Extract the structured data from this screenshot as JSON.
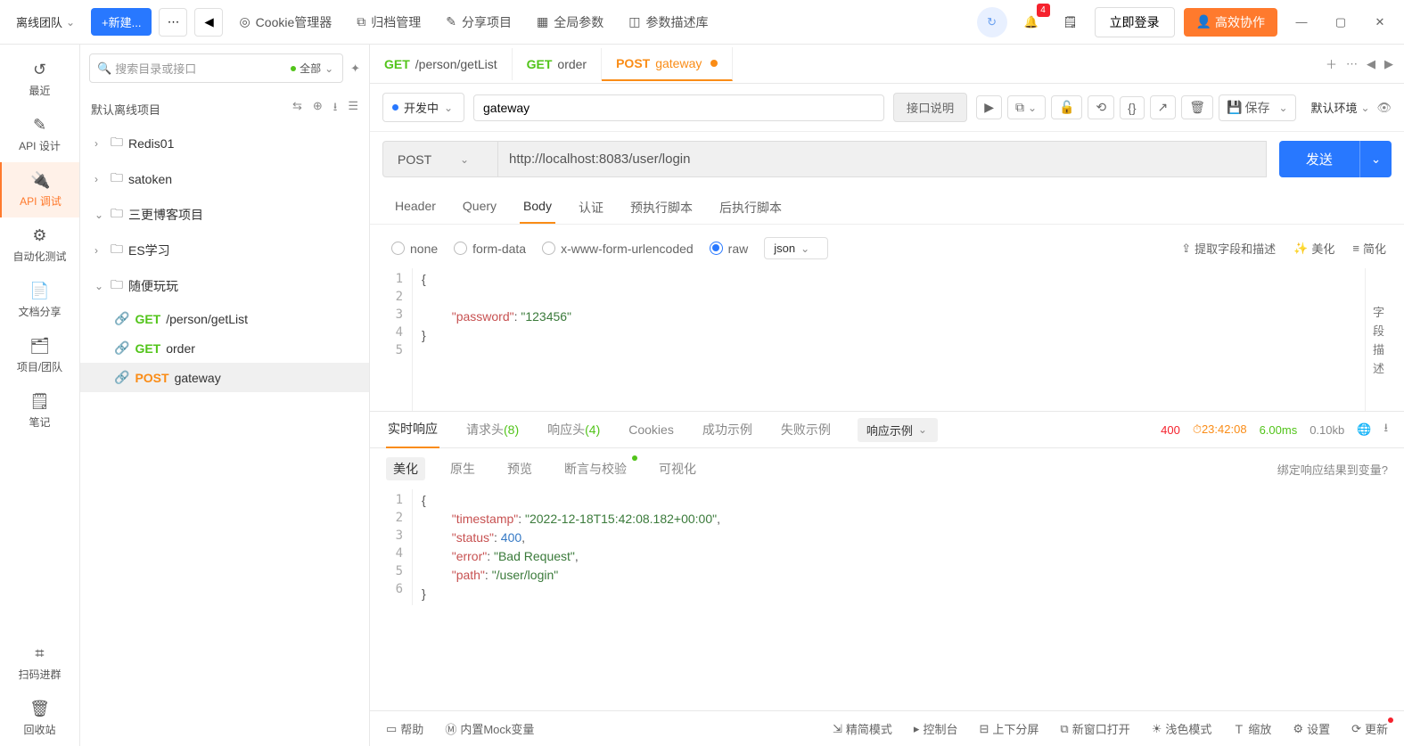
{
  "topbar": {
    "team": "离线团队",
    "new_btn": "+新建...",
    "cookie": "Cookie管理器",
    "archive": "归档管理",
    "share": "分享项目",
    "global": "全局参数",
    "paramlib": "参数描述库",
    "login": "立即登录",
    "collab": "高效协作",
    "notif_count": "4"
  },
  "sidebar": {
    "recent": "最近",
    "api_design": "API 设计",
    "api_debug": "API 调试",
    "auto_test": "自动化测试",
    "doc_share": "文档分享",
    "project": "项目/团队",
    "notes": "笔记",
    "scan": "扫码进群",
    "recycle": "回收站"
  },
  "tree": {
    "search_ph": "搜索目录或接口",
    "filter_all": "全部",
    "project_name": "默认离线项目",
    "folders": {
      "redis": "Redis01",
      "satoken": "satoken",
      "sangen": "三更博客项目",
      "es": "ES学习",
      "play": "随便玩玩"
    },
    "apis": {
      "getlist": {
        "method": "GET",
        "path": "/person/getList"
      },
      "order": {
        "method": "GET",
        "path": "order"
      },
      "gateway": {
        "method": "POST",
        "path": "gateway"
      }
    }
  },
  "tabs": {
    "t1": {
      "method": "GET",
      "name": "/person/getList"
    },
    "t2": {
      "method": "GET",
      "name": "order"
    },
    "t3": {
      "method": "POST",
      "name": "gateway"
    }
  },
  "request": {
    "status": "开发中",
    "name": "gateway",
    "desc_btn": "接口说明",
    "save": "保存",
    "env": "默认环境",
    "method": "POST",
    "url": "http://localhost:8083/user/login",
    "send": "发送"
  },
  "subtabs": {
    "header": "Header",
    "query": "Query",
    "body": "Body",
    "auth": "认证",
    "pre": "预执行脚本",
    "post": "后执行脚本"
  },
  "body_opts": {
    "none": "none",
    "formdata": "form-data",
    "urlenc": "x-www-form-urlencoded",
    "raw": "raw",
    "json": "json",
    "extract": "提取字段和描述",
    "beautify": "美化",
    "simplify": "简化"
  },
  "editor": {
    "l1": "{",
    "l3_key": "\"password\"",
    "l3_val": "\"123456\"",
    "l4": "}",
    "side_label": "字段描述"
  },
  "resp_tabs": {
    "realtime": "实时响应",
    "req_header": "请求头",
    "req_header_n": "(8)",
    "resp_header": "响应头",
    "resp_header_n": "(4)",
    "cookies": "Cookies",
    "success": "成功示例",
    "fail": "失败示例",
    "sample": "响应示例",
    "code": "400",
    "time": "23:42:08",
    "duration": "6.00ms",
    "size": "0.10kb"
  },
  "resp_sub": {
    "beautify": "美化",
    "raw": "原生",
    "preview": "预览",
    "assert": "断言与校验",
    "visual": "可视化",
    "bind": "绑定响应结果到变量?"
  },
  "response_body": {
    "l1": "{",
    "l2_k": "\"timestamp\"",
    "l2_v": "\"2022-12-18T15:42:08.182+00:00\"",
    "l3_k": "\"status\"",
    "l3_v": "400",
    "l4_k": "\"error\"",
    "l4_v": "\"Bad Request\"",
    "l5_k": "\"path\"",
    "l5_v": "\"/user/login\"",
    "l6": "}"
  },
  "bottom": {
    "help": "帮助",
    "mock": "内置Mock变量",
    "compact": "精简模式",
    "console": "控制台",
    "split": "上下分屏",
    "newwin": "新窗口打开",
    "light": "浅色模式",
    "zoom": "缩放",
    "settings": "设置",
    "update": "更新"
  }
}
